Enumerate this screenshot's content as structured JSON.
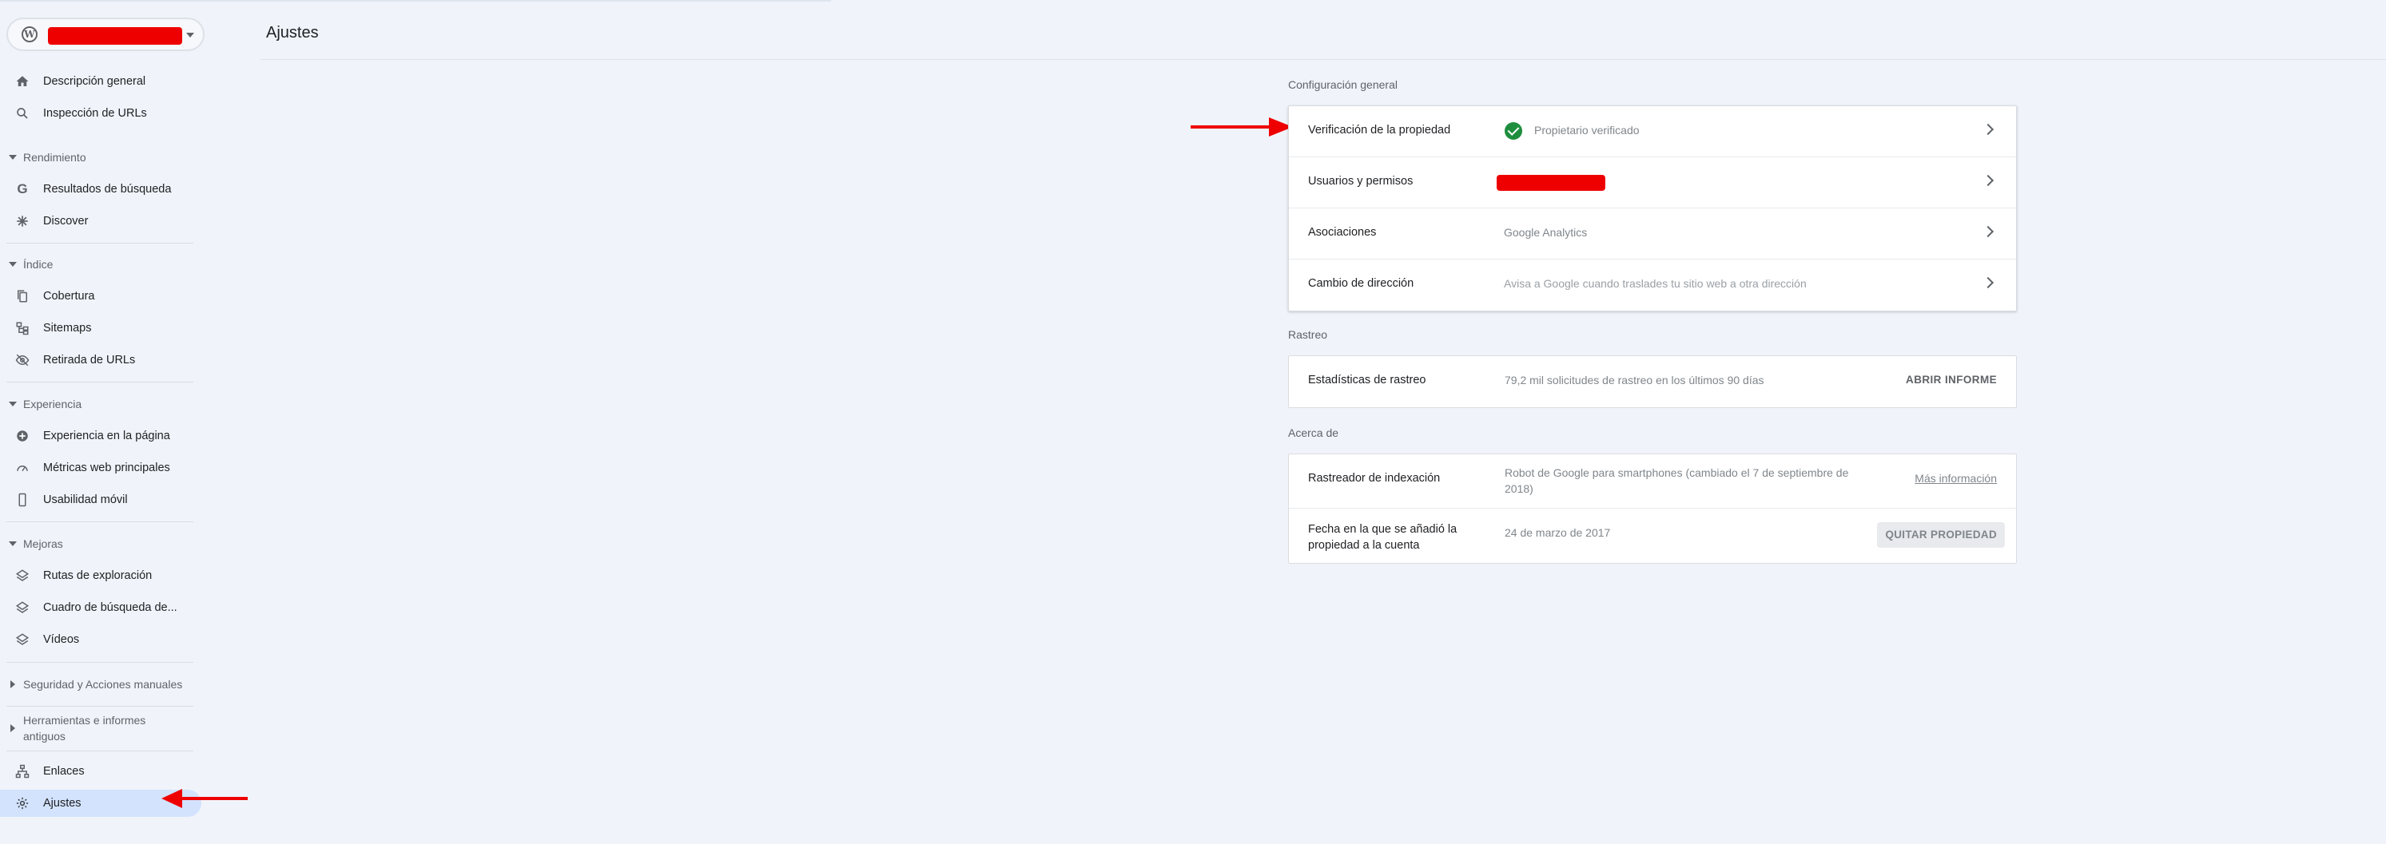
{
  "sidebar": {
    "top_items": [
      {
        "label": "Descripción general",
        "icon": "home-icon"
      },
      {
        "label": "Inspección de URLs",
        "icon": "search-icon"
      }
    ],
    "sections": {
      "rendimiento": {
        "label": "Rendimiento",
        "items": [
          {
            "label": "Resultados de búsqueda",
            "icon": "google-g-icon"
          },
          {
            "label": "Discover",
            "icon": "asterisk-icon"
          }
        ]
      },
      "indice": {
        "label": "Índice",
        "items": [
          {
            "label": "Cobertura",
            "icon": "copy-icon"
          },
          {
            "label": "Sitemaps",
            "icon": "sitemap-icon"
          },
          {
            "label": "Retirada de URLs",
            "icon": "eye-off-icon"
          }
        ]
      },
      "experiencia": {
        "label": "Experiencia",
        "items": [
          {
            "label": "Experiencia en la página",
            "icon": "add-circle-icon"
          },
          {
            "label": "Métricas web principales",
            "icon": "speed-icon"
          },
          {
            "label": "Usabilidad móvil",
            "icon": "phone-icon"
          }
        ]
      },
      "mejoras": {
        "label": "Mejoras",
        "items": [
          {
            "label": "Rutas de exploración",
            "icon": "layers-icon"
          },
          {
            "label": "Cuadro de búsqueda de...",
            "icon": "layers-icon"
          },
          {
            "label": "Vídeos",
            "icon": "layers-icon"
          }
        ]
      },
      "seguridad": {
        "label": "Seguridad y Acciones manuales"
      },
      "herramientas": {
        "label_line1": "Herramientas e informes",
        "label_line2": "antiguos"
      }
    },
    "bottom_items": [
      {
        "label": "Enlaces",
        "icon": "links-icon"
      },
      {
        "label": "Ajustes",
        "icon": "gear-icon"
      }
    ]
  },
  "header": {
    "title": "Ajustes"
  },
  "main": {
    "general": {
      "label": "Configuración general",
      "rows": [
        {
          "key": "Verificación de la propiedad",
          "value": "Propietario verificado"
        },
        {
          "key": "Usuarios y permisos",
          "value": ""
        },
        {
          "key": "Asociaciones",
          "value": "Google Analytics"
        },
        {
          "key": "Cambio de dirección",
          "value": "Avisa a Google cuando traslades tu sitio web a otra dirección"
        }
      ]
    },
    "rastreo": {
      "label": "Rastreo",
      "key": "Estadísticas de rastreo",
      "value": "79,2 mil solicitudes de rastreo en los últimos 90 días",
      "action": "ABRIR INFORME"
    },
    "acerca": {
      "label": "Acerca de",
      "crawler_key": "Rastreador de indexación",
      "crawler_value": "Robot de Google para smartphones (cambiado el 7 de septiembre de 2018)",
      "crawler_link": "Más información",
      "date_key": "Fecha en la que se añadió la propiedad a la cuenta",
      "date_value": "24 de marzo de 2017",
      "remove_action": "QUITAR PROPIEDAD"
    }
  },
  "colors": {
    "accent_active": "#d3e3fd",
    "verified_green": "#1e8e3e",
    "annotation_red": "#ee0000"
  }
}
